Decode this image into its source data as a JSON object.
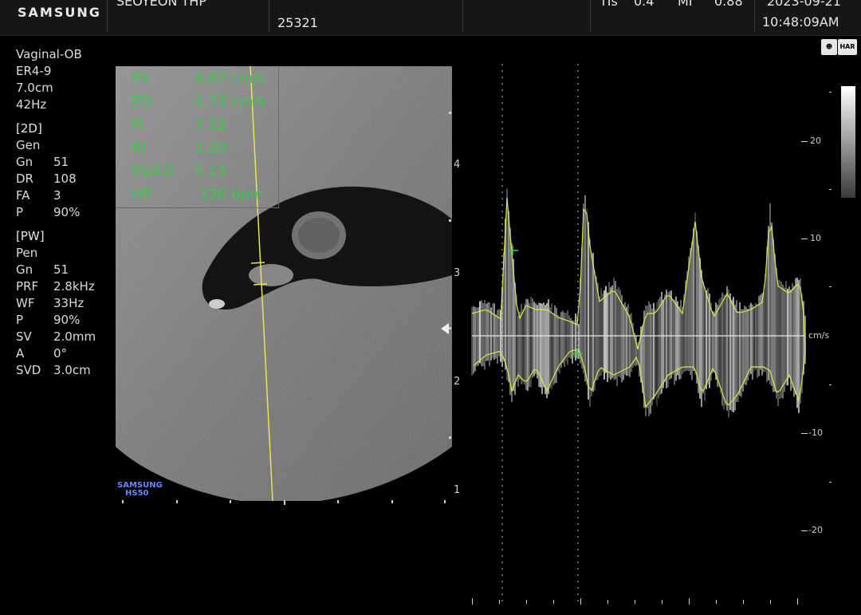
{
  "header": {
    "brand": "SAMSUNG",
    "patient": "SEOYEON THP",
    "id": "25321",
    "tis_label": "TIs",
    "tis_value": "0.4",
    "mi_label": "MI",
    "mi_value": "0.88",
    "date": "2023-09-21",
    "time": "10:48:09AM"
  },
  "preset": {
    "exam": "Vaginal-OB",
    "probe": "ER4-9",
    "depth": "7.0cm",
    "frame_rate": "42Hz"
  },
  "mode_2d": {
    "title": "[2D]",
    "mode": "Gen",
    "rows": [
      {
        "k": "Gn",
        "v": "51"
      },
      {
        "k": "DR",
        "v": "108"
      },
      {
        "k": "FA",
        "v": "3"
      },
      {
        "k": "P",
        "v": "90%"
      }
    ]
  },
  "mode_pw": {
    "title": "[PW]",
    "mode": "Pen",
    "rows": [
      {
        "k": "Gn",
        "v": "51"
      },
      {
        "k": "PRF",
        "v": "2.8kHz"
      },
      {
        "k": "WF",
        "v": "33Hz"
      },
      {
        "k": "P",
        "v": "90%"
      },
      {
        "k": "SV",
        "v": "2.0mm"
      },
      {
        "k": "A",
        "v": "0°"
      },
      {
        "k": "SVD",
        "v": "3.0cm"
      }
    ]
  },
  "measurements": [
    {
      "label": "PS",
      "value": "8.87 cm/s"
    },
    {
      "label": "ED",
      "value": "-1.73 cm/s"
    },
    {
      "label": "PI",
      "value": "7.12"
    },
    {
      "label": "RI",
      "value": "1.20"
    },
    {
      "label": "PS/ED",
      "value": "5.13"
    },
    {
      "label": "HR",
      "value": "136 bpm"
    }
  ],
  "depth_scale": [
    "4",
    "3",
    "2",
    "1"
  ],
  "velocity_scale": {
    "labels": [
      "20",
      "10",
      "cm/s",
      "-10",
      "-20"
    ],
    "unit": "cm/s"
  },
  "probe_brand": {
    "line1": "SAMSUNG",
    "line2": "HS50"
  },
  "icons": {
    "a": "baby-face-icon",
    "b": "HAR"
  },
  "colors": {
    "measure": "#3cc84a",
    "cursor": "#e8e84a",
    "trace": "#d8e84a"
  }
}
